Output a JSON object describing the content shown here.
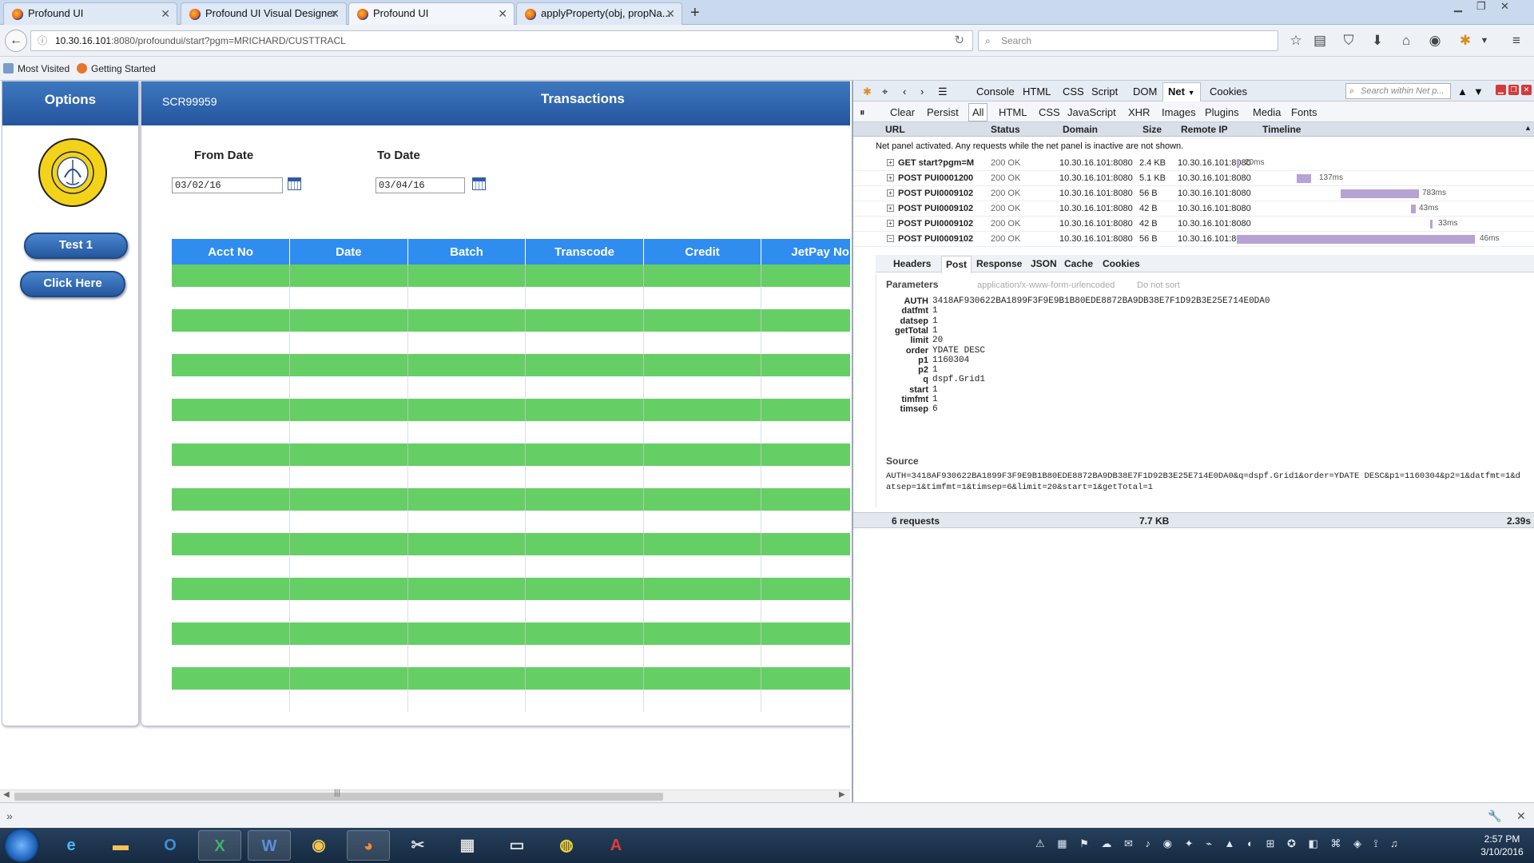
{
  "browser": {
    "tabs": [
      {
        "label": "Profound UI"
      },
      {
        "label": "Profound UI Visual Designer"
      },
      {
        "label": "Profound UI"
      },
      {
        "label": "applyProperty(obj, propNa..."
      }
    ],
    "url_host": "10.30.16.101",
    "url_path": ":8080/profoundui/start?pgm=MRICHARD/CUSTTRACL",
    "search_placeholder": "Search",
    "bookmarks": [
      {
        "label": "Most Visited"
      },
      {
        "label": "Getting Started"
      }
    ]
  },
  "app": {
    "options_title": "Options",
    "screen_id": "SCR99959",
    "page_title": "Transactions",
    "logo_text": "SYLACAUGA UTILITIES BOARD",
    "buttons": {
      "test1": "Test 1",
      "click_here": "Click Here"
    },
    "from_date_label": "From Date",
    "to_date_label": "To Date",
    "from_date": "03/02/16",
    "to_date": "03/04/16",
    "grid_columns": [
      "Acct No",
      "Date",
      "Batch",
      "Transcode",
      "Credit",
      "JetPay No"
    ]
  },
  "firebug": {
    "tabs": [
      "Console",
      "HTML",
      "CSS",
      "Script",
      "DOM",
      "Net",
      "Cookies"
    ],
    "active_tab": "Net",
    "search_placeholder": "Search within Net p...",
    "toolbar": [
      "Clear",
      "Persist",
      "All",
      "HTML",
      "CSS",
      "JavaScript",
      "XHR",
      "Images",
      "Plugins",
      "Media",
      "Fonts"
    ],
    "columns": [
      "URL",
      "Status",
      "Domain",
      "Size",
      "Remote IP",
      "Timeline"
    ],
    "note": "Net panel activated. Any requests while the net panel is inactive are not shown.",
    "requests": [
      {
        "url": "GET start?pgm=M",
        "status": "200 OK",
        "domain": "10.30.16.101:8080",
        "size": "2.4 KB",
        "ip": "10.30.16.101:8080",
        "time": "20ms",
        "expanded": false
      },
      {
        "url": "POST PUI0001200",
        "status": "200 OK",
        "domain": "10.30.16.101:8080",
        "size": "5.1 KB",
        "ip": "10.30.16.101:8080",
        "time": "137ms",
        "expanded": false
      },
      {
        "url": "POST PUI0009102",
        "status": "200 OK",
        "domain": "10.30.16.101:8080",
        "size": "56 B",
        "ip": "10.30.16.101:8080",
        "time": "783ms",
        "expanded": false
      },
      {
        "url": "POST PUI0009102",
        "status": "200 OK",
        "domain": "10.30.16.101:8080",
        "size": "42 B",
        "ip": "10.30.16.101:8080",
        "time": "43ms",
        "expanded": false
      },
      {
        "url": "POST PUI0009102",
        "status": "200 OK",
        "domain": "10.30.16.101:8080",
        "size": "42 B",
        "ip": "10.30.16.101:8080",
        "time": "33ms",
        "expanded": false
      },
      {
        "url": "POST PUI0009102",
        "status": "200 OK",
        "domain": "10.30.16.101:8080",
        "size": "56 B",
        "ip": "10.30.16.101:8080",
        "time": "46ms",
        "expanded": true
      }
    ],
    "detail_tabs": [
      "Headers",
      "Post",
      "Response",
      "JSON",
      "Cache",
      "Cookies"
    ],
    "detail_active": "Post",
    "params_label": "Parameters",
    "params_encoding": "application/x-www-form-urlencoded",
    "params_sort": "Do not sort",
    "params": [
      {
        "k": "AUTH",
        "v": "3418AF930622BA1899F3F9E9B1B80EDE8872BA9DB38E7F1D92B3E25E714E0DA0"
      },
      {
        "k": "datfmt",
        "v": "1"
      },
      {
        "k": "datsep",
        "v": "1"
      },
      {
        "k": "getTotal",
        "v": "1"
      },
      {
        "k": "limit",
        "v": "20"
      },
      {
        "k": "order",
        "v": "YDATE DESC"
      },
      {
        "k": "p1",
        "v": "1160304"
      },
      {
        "k": "p2",
        "v": "1"
      },
      {
        "k": "q",
        "v": "dspf.Grid1"
      },
      {
        "k": "start",
        "v": "1"
      },
      {
        "k": "timfmt",
        "v": "1"
      },
      {
        "k": "timsep",
        "v": "6"
      }
    ],
    "source_label": "Source",
    "source": "AUTH=3418AF930622BA1899F3F9E9B1B80EDE8872BA9DB38E7F1D92B3E25E714E0DA0&q=dspf.Grid1&order=YDATE DESC&p1=1160304&p2=1&datfmt=1&datsep=1&timfmt=1&timsep=6&limit=20&start=1&getTotal=1",
    "summary_requests": "6 requests",
    "summary_size": "7.7 KB",
    "summary_time": "2.39s"
  },
  "taskbar": {
    "time": "2:57 PM",
    "date": "3/10/2016"
  },
  "colors": {
    "header_blue": "#2f6db5",
    "grid_header": "#2f8df0",
    "grid_green": "#65cf65",
    "timeline_bar": "#b7a2d4"
  }
}
